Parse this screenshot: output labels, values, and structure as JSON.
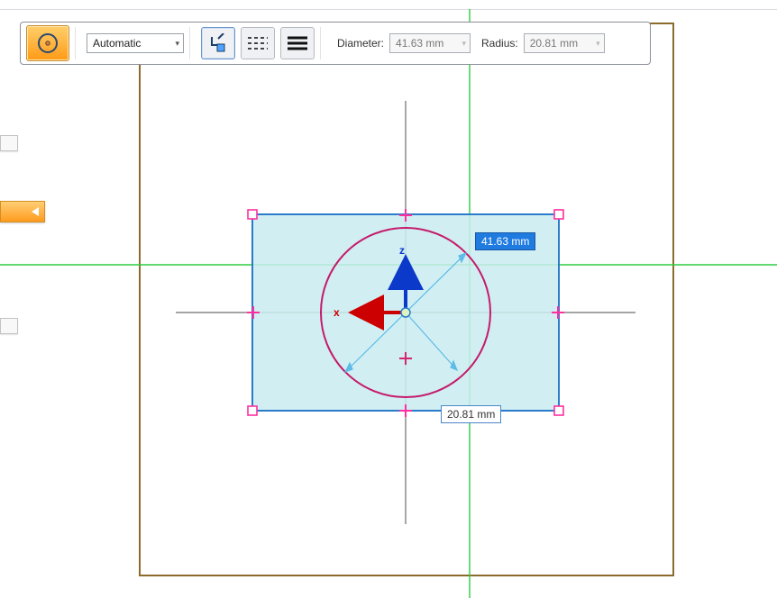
{
  "toolbar": {
    "mode_label": "Automatic",
    "diameter_label": "Diameter:",
    "radius_label": "Radius:",
    "diameter_value": "41.63 mm",
    "radius_value": "20.81 mm"
  },
  "canvas": {
    "axes": {
      "x_label": "x",
      "z_label": "z"
    },
    "dimensions": {
      "diameter_display": "41.63 mm",
      "radius_display": "20.81 mm"
    }
  },
  "chart_data": {
    "type": "diagram",
    "shapes": [
      {
        "name": "circle",
        "center": [
          0,
          0
        ],
        "radius_mm": 20.81,
        "diameter_mm": 41.63,
        "color": "#c51a6b"
      },
      {
        "name": "bounding-rect-selected",
        "x_mm": -37.7,
        "y_mm": -24.2,
        "w_mm": 75.4,
        "h_mm": 48.4,
        "color": "#2a7bc9",
        "fill": "#c9ecf0"
      }
    ],
    "origin_marker": {
      "x_axis_color": "#cc0000",
      "z_axis_color": "#0033cc"
    },
    "guides": {
      "green_cross": true,
      "outer_brown_frame": true
    }
  }
}
